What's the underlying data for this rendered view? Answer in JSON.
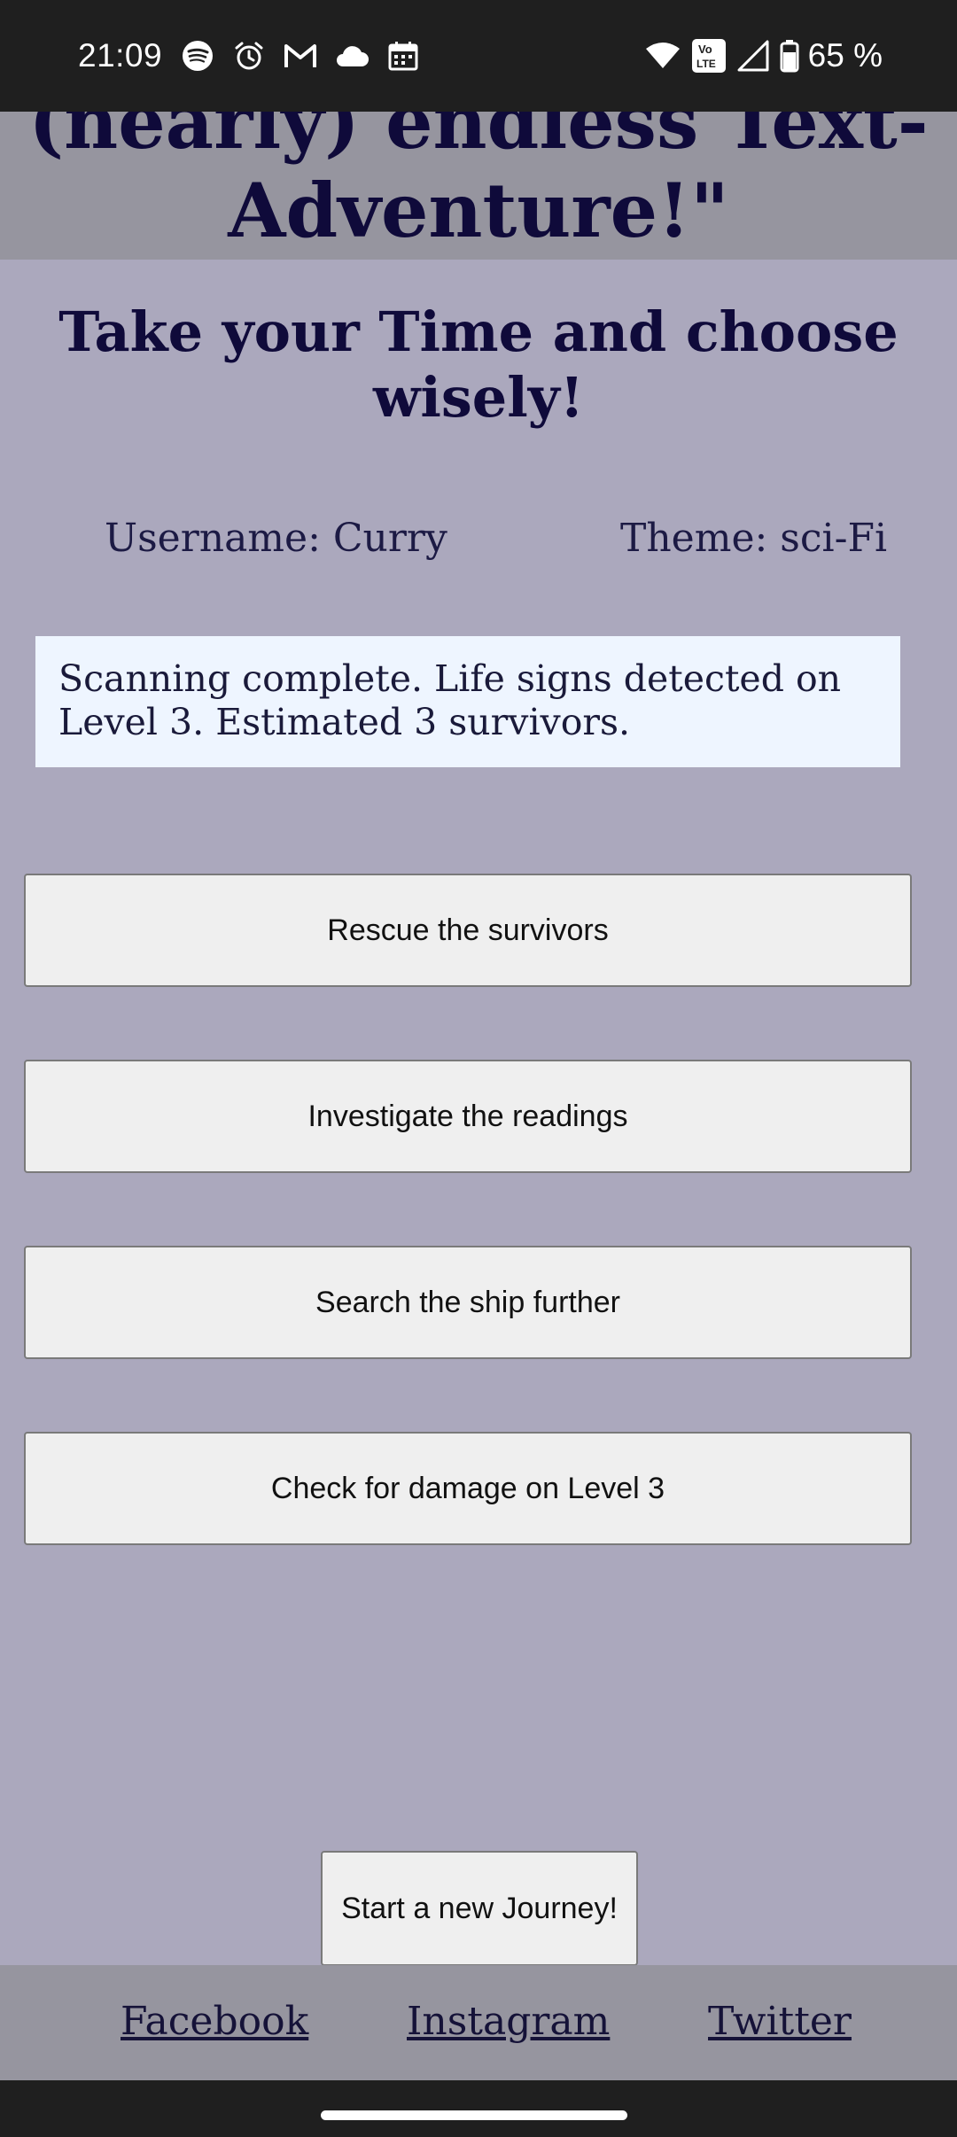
{
  "status_bar": {
    "time": "21:09",
    "left_icons": [
      "spotify-icon",
      "alarm-icon",
      "gmail-icon",
      "cloud-icon",
      "calendar-icon"
    ],
    "right_icons": [
      "wifi-icon",
      "volte-icon",
      "signal-icon",
      "battery-icon"
    ],
    "volte_label": "Vo LTE",
    "battery_percent": 65,
    "battery_text": "65 %"
  },
  "header": {
    "title_line1": "(nearly) endless Text-",
    "title_line2": "Adventure!\""
  },
  "subtitle": "Take your Time and choose wisely!",
  "info": {
    "username": "Username: Curry",
    "theme": "Theme: sci-Fi"
  },
  "story": {
    "text": "Scanning complete. Life signs detected on Level 3. Estimated 3 survivors."
  },
  "choices": [
    {
      "label": "Rescue the survivors"
    },
    {
      "label": "Investigate the readings"
    },
    {
      "label": "Search the ship further"
    },
    {
      "label": "Check for damage on Level 3"
    }
  ],
  "new_journey_label": "Start a new Journey!",
  "footer": {
    "links": [
      "Facebook",
      "Instagram",
      "Twitter"
    ]
  },
  "colors": {
    "page_bg": "#aba8bd",
    "band_bg": "#96959f",
    "title_color": "#0f0a3a",
    "story_bg": "#eef5ff",
    "button_bg": "#efefef",
    "system_bar_bg": "#1f1f1f"
  }
}
